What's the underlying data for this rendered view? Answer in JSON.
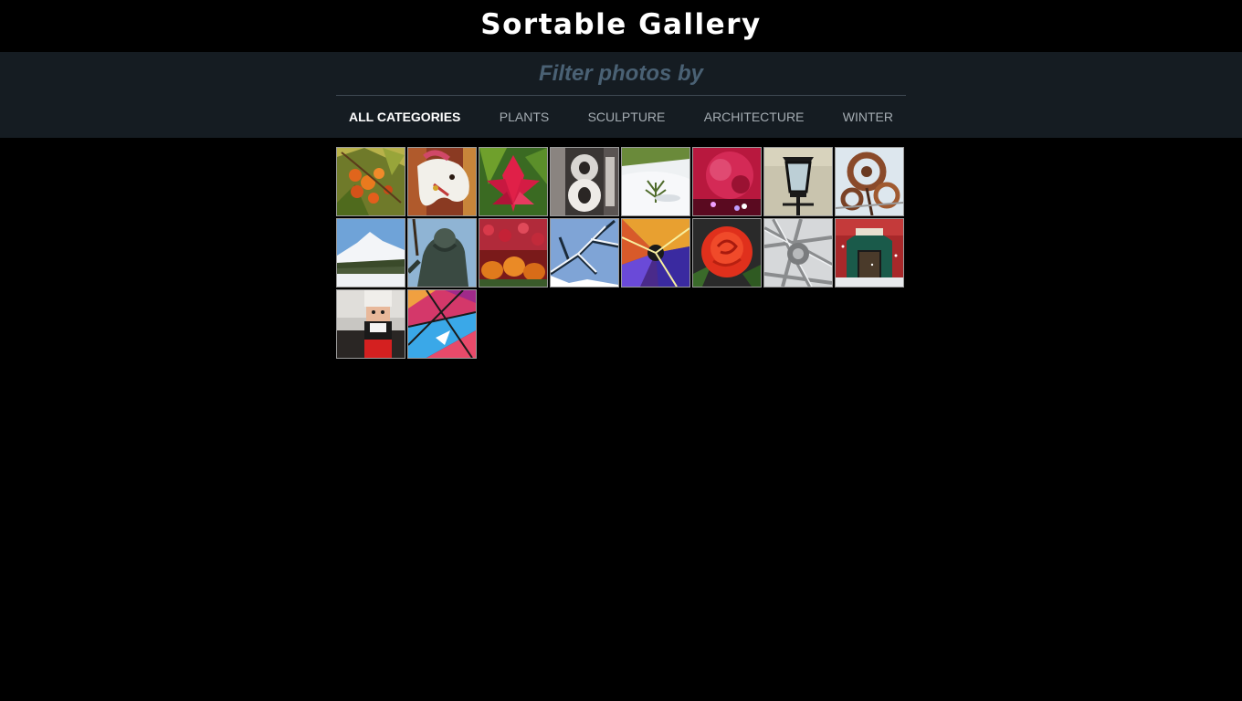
{
  "header": {
    "title": "Sortable Gallery"
  },
  "filter": {
    "heading": "Filter photos by",
    "categories": [
      {
        "label": "ALL CATEGORIES",
        "active": true
      },
      {
        "label": "PLANTS",
        "active": false
      },
      {
        "label": "SCULPTURE",
        "active": false
      },
      {
        "label": "ARCHITECTURE",
        "active": false
      },
      {
        "label": "WINTER",
        "active": false
      }
    ]
  },
  "gallery": {
    "photos": [
      {
        "subject": "orange-berries-photo"
      },
      {
        "subject": "carousel-horse-photo"
      },
      {
        "subject": "red-flower-photo"
      },
      {
        "subject": "metal-number-8-photo"
      },
      {
        "subject": "plant-in-snow-photo"
      },
      {
        "subject": "pink-lights-photo"
      },
      {
        "subject": "street-lantern-photo"
      },
      {
        "subject": "metal-flower-sculpture-photo"
      },
      {
        "subject": "snowy-mountain-photo"
      },
      {
        "subject": "bronze-statue-photo"
      },
      {
        "subject": "pumpkins-flowers-photo"
      },
      {
        "subject": "snowy-branches-photo"
      },
      {
        "subject": "colorful-light-burst-photo"
      },
      {
        "subject": "red-rose-photo"
      },
      {
        "subject": "steel-sculpture-photo"
      },
      {
        "subject": "storefront-in-snow-photo"
      },
      {
        "subject": "nutcracker-photo"
      },
      {
        "subject": "colored-glass-ceiling-photo"
      }
    ]
  },
  "colors": {
    "page_background": "#000000",
    "filter_band": "#151c22",
    "heading_text": "#4a6174",
    "nav_text": "#a5adb3",
    "nav_active": "#ffffff"
  }
}
